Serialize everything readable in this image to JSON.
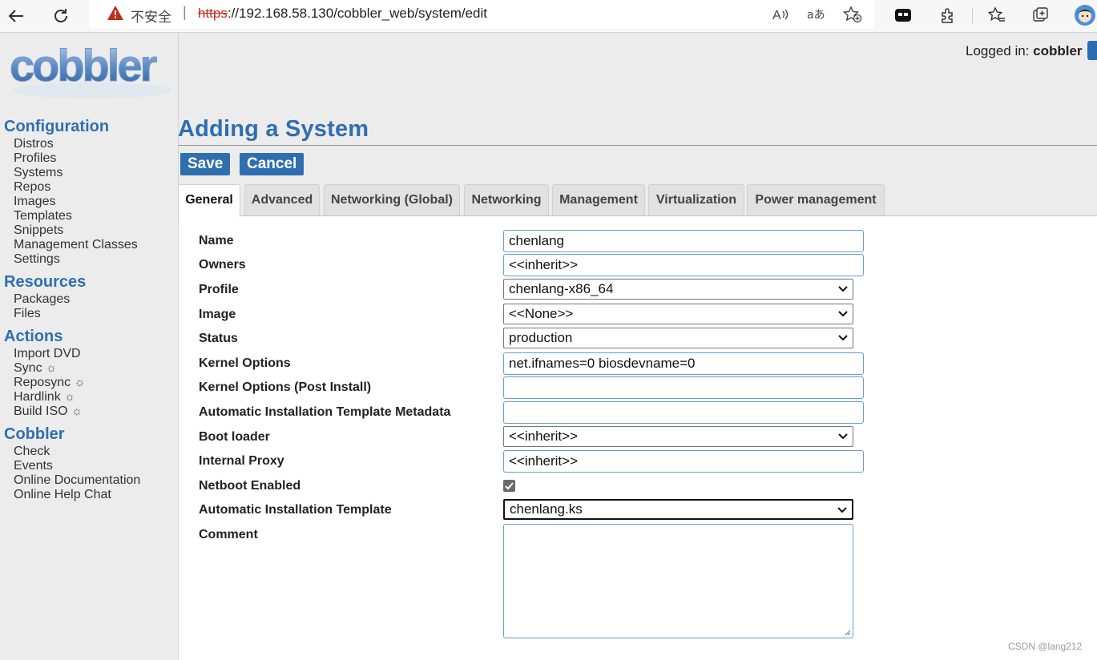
{
  "browser": {
    "insecure_label": "不安全",
    "separator": "|",
    "url_protocol": "https",
    "url_rest": "://192.168.58.130/cobbler_web/system/edit"
  },
  "header": {
    "logged_in_label": "Logged in: ",
    "username": "cobbler",
    "logo_text": "cobbler"
  },
  "sidebar": {
    "configuration": {
      "heading": "Configuration",
      "items": [
        "Distros",
        "Profiles",
        "Systems",
        "Repos",
        "Images",
        "Templates",
        "Snippets",
        "Management Classes",
        "Settings"
      ]
    },
    "resources": {
      "heading": "Resources",
      "items": [
        "Packages",
        "Files"
      ]
    },
    "actions": {
      "heading": "Actions",
      "items": [
        "Import DVD",
        "Sync",
        "Reposync",
        "Hardlink",
        "Build ISO"
      ],
      "gear": "☼"
    },
    "cobbler": {
      "heading": "Cobbler",
      "items": [
        "Check",
        "Events",
        "Online Documentation",
        "Online Help Chat"
      ]
    }
  },
  "main": {
    "title": "Adding a System",
    "save_label": "Save",
    "cancel_label": "Cancel",
    "tabs": [
      "General",
      "Advanced",
      "Networking (Global)",
      "Networking",
      "Management",
      "Virtualization",
      "Power management"
    ],
    "active_tab": "General"
  },
  "form": {
    "name": {
      "label": "Name",
      "value": "chenlang"
    },
    "owners": {
      "label": "Owners",
      "value": "<<inherit>>"
    },
    "profile": {
      "label": "Profile",
      "value": "chenlang-x86_64"
    },
    "image": {
      "label": "Image",
      "value": "<<None>>"
    },
    "status": {
      "label": "Status",
      "value": "production"
    },
    "kernel_options": {
      "label": "Kernel Options",
      "value": "net.ifnames=0 biosdevname=0"
    },
    "kernel_options_post": {
      "label": "Kernel Options (Post Install)",
      "value": ""
    },
    "autoinstall_meta": {
      "label": "Automatic Installation Template Metadata",
      "value": ""
    },
    "boot_loader": {
      "label": "Boot loader",
      "value": "<<inherit>>"
    },
    "internal_proxy": {
      "label": "Internal Proxy",
      "value": "<<inherit>>"
    },
    "netboot": {
      "label": "Netboot Enabled",
      "checked": true
    },
    "autoinstall": {
      "label": "Automatic Installation Template",
      "value": "chenlang.ks"
    },
    "comment": {
      "label": "Comment",
      "value": ""
    }
  },
  "watermark": "CSDN @lang212"
}
